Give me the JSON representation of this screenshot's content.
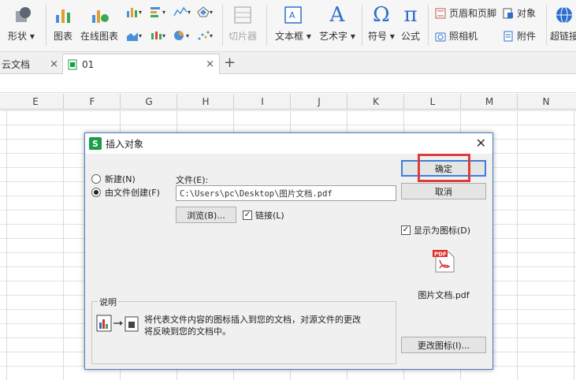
{
  "ribbon": {
    "shape_label": "形状",
    "chart_label": "图表",
    "online_chart_label": "在线图表",
    "slicer_label": "切片器",
    "textbox_label": "文本框",
    "wordart_label": "艺术字",
    "symbol_label": "符号",
    "formula_label": "公式",
    "header_footer_label": "页眉和页脚",
    "object_label": "对象",
    "camera_label": "照相机",
    "attachment_label": "附件",
    "hyperlink_label": "超链接"
  },
  "tabs": [
    {
      "label": "云文档"
    },
    {
      "label": "01"
    }
  ],
  "columns": [
    "E",
    "F",
    "G",
    "H",
    "I",
    "J",
    "K",
    "L",
    "M",
    "N"
  ],
  "dialog": {
    "title": "插入对象",
    "new_label": "新建(N)",
    "from_file_label": "由文件创建(F)",
    "file_label": "文件(E):",
    "file_path": "C:\\Users\\pc\\Desktop\\图片文档.pdf",
    "browse_label": "浏览(B)...",
    "link_label": "链接(L)",
    "link_checked": true,
    "ok_label": "确定",
    "cancel_label": "取消",
    "display_as_icon_label": "显示为图标(D)",
    "display_as_icon_checked": true,
    "pdf_badge": "PDF",
    "icon_filename": "图片文档.pdf",
    "change_icon_label": "更改图标(I)...",
    "result_title": "说明",
    "result_line1": "将代表文件内容的图标插入到您的文档，对源文件的更改",
    "result_line2": "将反映到您的文档中。",
    "selected_option": "from_file"
  },
  "colors": {
    "accent": "#3c7fd8",
    "highlight": "#e03b3b",
    "wps_green": "#1a9c4b",
    "ribbon_blue": "#2c6fce"
  }
}
